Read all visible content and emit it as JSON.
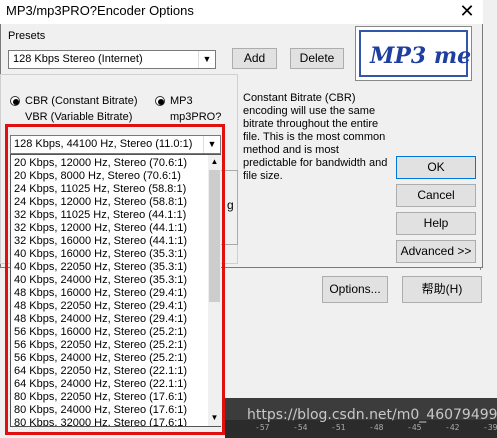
{
  "window": {
    "title": "MP3/mp3PRO?Encoder Options",
    "close_glyph": "✕"
  },
  "presets": {
    "label": "Presets",
    "selected": "128 Kbps Stereo (Internet)",
    "add_label": "Add",
    "delete_label": "Delete"
  },
  "logo": {
    "text": "MP3 me!"
  },
  "modes": {
    "cbr_label": "CBR (Constant Bitrate)",
    "vbr_label": "VBR (Variable Bitrate)",
    "mp3_label": "MP3",
    "mp3pro_label": "mp3PRO?",
    "selected_mode": "CBR (Constant Bitrate)",
    "selected_format": "MP3"
  },
  "description": "Constant Bitrate (CBR) encoding will use the same bitrate throughout the entire file.  This is the most common method and is most predictable for bandwidth and file size.",
  "buttons": {
    "ok": "OK",
    "cancel": "Cancel",
    "help": "Help",
    "advanced": "Advanced >>",
    "options": "Options...",
    "help_cn": "帮助(H)"
  },
  "behind_text": "g",
  "bitrate": {
    "selected": "128 Kbps, 44100 Hz, Stereo (11.0:1)",
    "options": [
      "20 Kbps, 12000 Hz, Stereo (70.6:1)",
      "20 Kbps, 8000 Hz, Stereo (70.6:1)",
      "24 Kbps, 11025 Hz, Stereo (58.8:1)",
      "24 Kbps, 12000 Hz, Stereo (58.8:1)",
      "32 Kbps, 11025 Hz, Stereo (44.1:1)",
      "32 Kbps, 12000 Hz, Stereo (44.1:1)",
      "32 Kbps, 16000 Hz, Stereo (44.1:1)",
      "40 Kbps, 16000 Hz, Stereo (35.3:1)",
      "40 Kbps, 22050 Hz, Stereo (35.3:1)",
      "40 Kbps, 24000 Hz, Stereo (35.3:1)",
      "48 Kbps, 16000 Hz, Stereo (29.4:1)",
      "48 Kbps, 22050 Hz, Stereo (29.4:1)",
      "48 Kbps, 24000 Hz, Stereo (29.4:1)",
      "56 Kbps, 16000 Hz, Stereo (25.2:1)",
      "56 Kbps, 22050 Hz, Stereo (25.2:1)",
      "56 Kbps, 24000 Hz, Stereo (25.2:1)",
      "64 Kbps, 22050 Hz, Stereo (22.1:1)",
      "64 Kbps, 24000 Hz, Stereo (22.1:1)",
      "80 Kbps, 22050 Hz, Stereo (17.6:1)",
      "80 Kbps, 24000 Hz, Stereo (17.6:1)",
      "80 Kbps, 32000 Hz, Stereo (17.6:1)"
    ]
  },
  "watermark": "https://blog.csdn.net/m0_46079499",
  "ruler_ticks": [
    "-57",
    "-54",
    "-51",
    "-48",
    "-45",
    "-42",
    "-39"
  ],
  "colors": {
    "highlight": "#e01010",
    "ok_border": "#0078d7"
  }
}
